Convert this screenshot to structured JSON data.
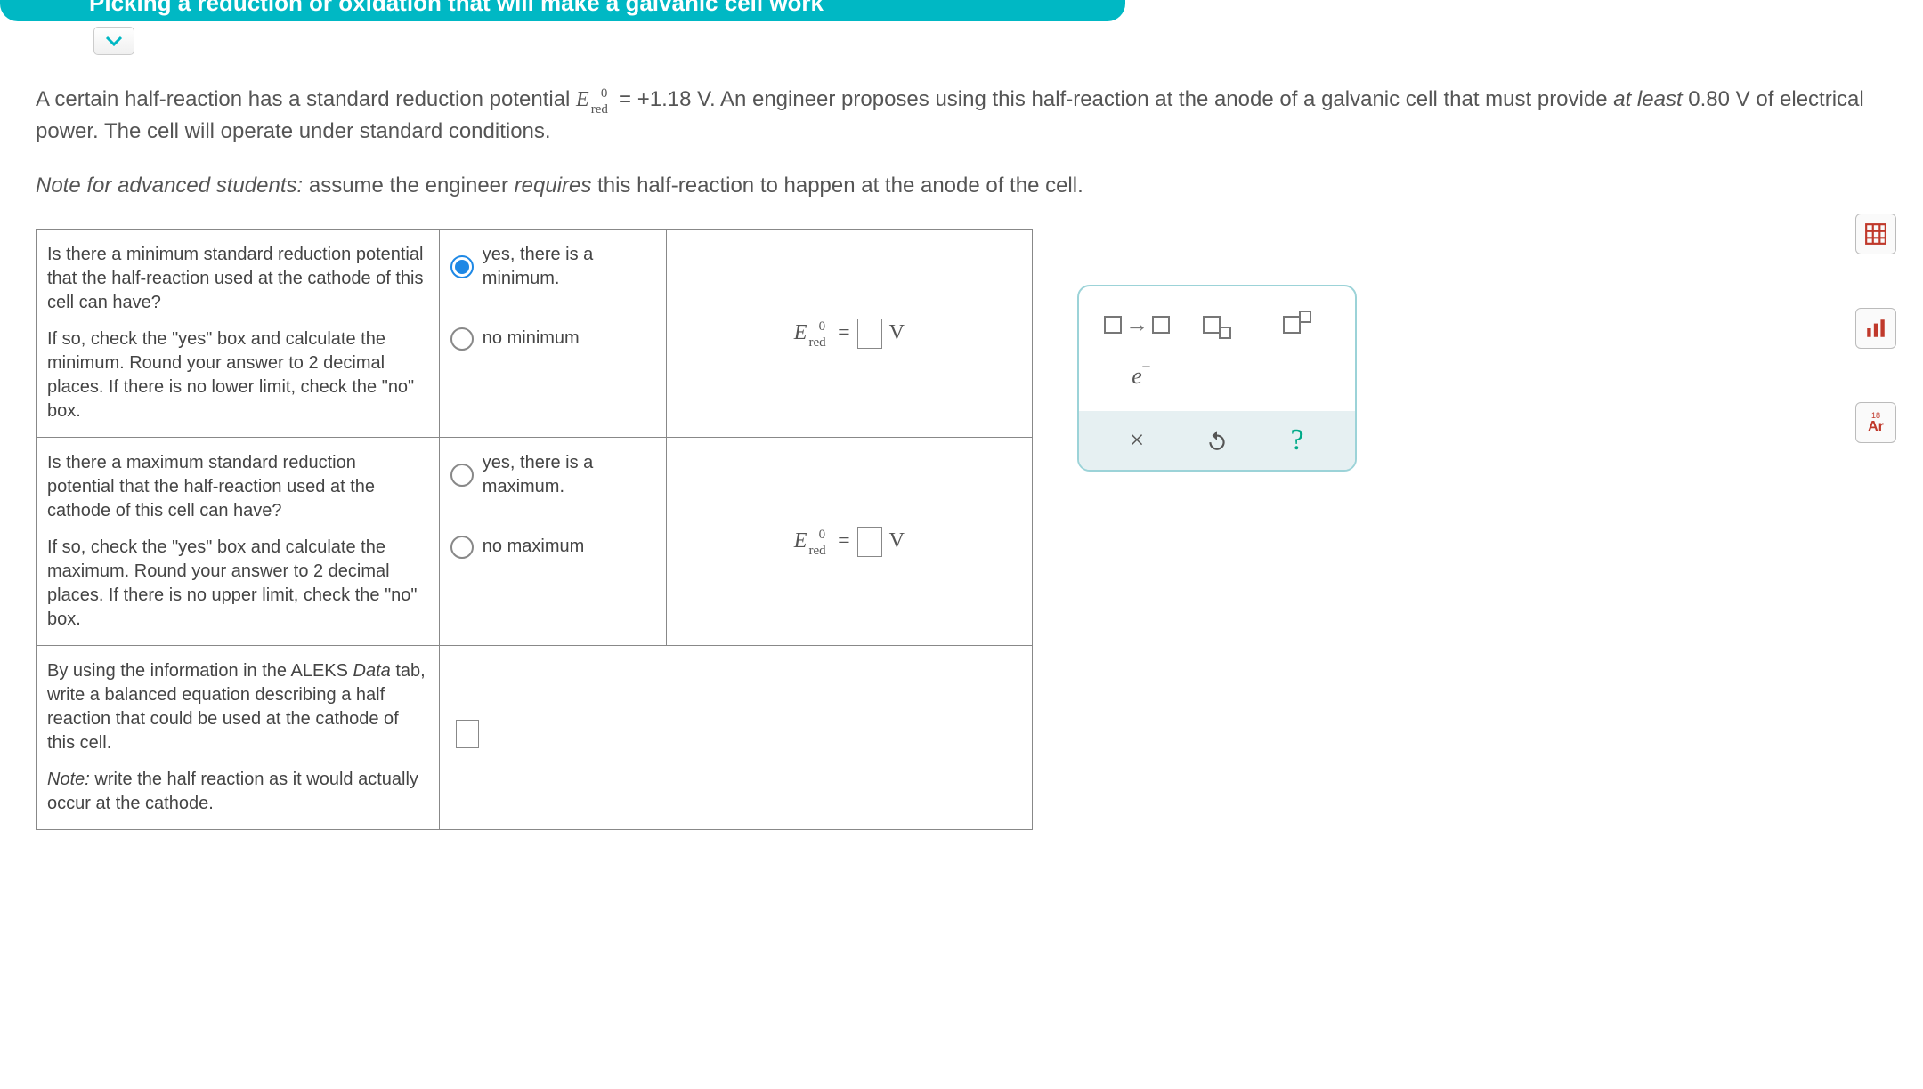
{
  "header": {
    "title": "Picking a reduction or oxidation that will make a galvanic cell work"
  },
  "intro": {
    "part1": "A certain half-reaction has a standard reduction potential ",
    "ered_value": "= +1.18 V",
    "part2": ". An engineer proposes using this half-reaction at the anode of a galvanic cell that must provide ",
    "at_least": "at least",
    "voltage": " 0.80 V of electrical power. The cell will operate under standard conditions."
  },
  "note": {
    "prefix": "Note for advanced students:",
    "body": " assume the engineer ",
    "requires": "requires",
    "rest": " this half-reaction to happen at the anode of the cell."
  },
  "rows": {
    "min": {
      "q1": "Is there a minimum standard reduction potential that the half-reaction used at the cathode of this cell can have?",
      "q2": "If so, check the \"yes\" box and calculate the minimum. Round your answer to 2 decimal places. If there is no lower limit, check the \"no\" box.",
      "opt_yes": "yes, there is a minimum.",
      "opt_no": "no minimum",
      "selected": "yes",
      "unit": "V"
    },
    "max": {
      "q1": "Is there a maximum standard reduction potential that the half-reaction used at the cathode of this cell can have?",
      "q2": "If so, check the \"yes\" box and calculate the maximum. Round your answer to 2 decimal places. If there is no upper limit, check the \"no\" box.",
      "opt_yes": "yes, there is a maximum.",
      "opt_no": "no maximum",
      "selected": "",
      "unit": "V"
    },
    "eq": {
      "q1_a": "By using the information in the ALEKS ",
      "q1_b": "Data",
      "q1_c": " tab, write a balanced equation describing a half reaction that could be used at the cathode of this cell.",
      "q2_a": "Note:",
      "q2_b": " write the half reaction as it would actually occur at the cathode."
    }
  },
  "palette": {
    "electron": "e",
    "clear": "×",
    "reset": "↺",
    "help": "?"
  },
  "side_tools": {
    "table": "⊞",
    "graph": "₀₀₀",
    "periodic": "Ar"
  }
}
